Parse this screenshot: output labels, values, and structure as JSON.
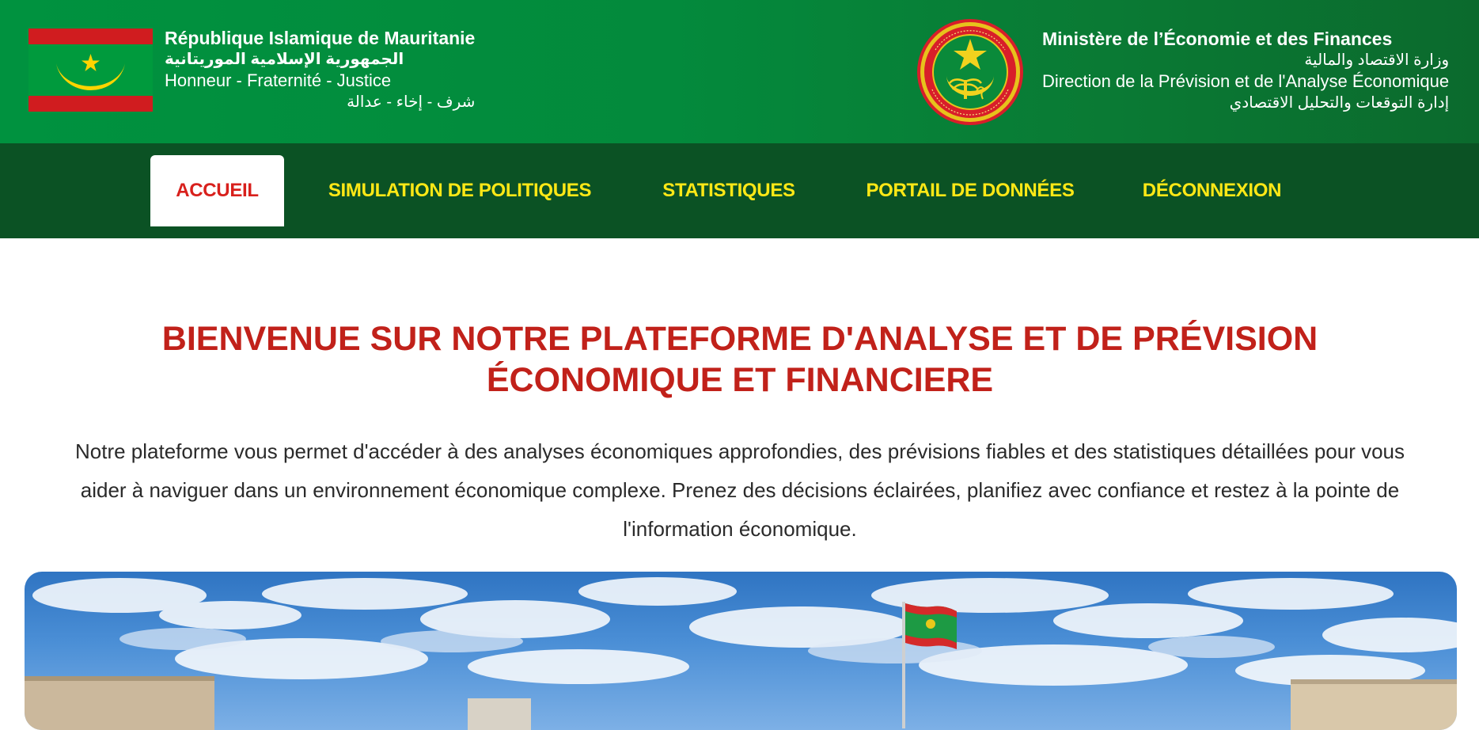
{
  "header": {
    "country_fr": "République Islamique de Mauritanie",
    "country_ar": "الجمهورية الإسلامية الموريتانية",
    "motto_fr": "Honneur - Fraternité - Justice",
    "motto_ar": "شرف - إخاء - عدالة",
    "ministry_fr": "Ministère de l’Économie et des Finances",
    "ministry_ar": "وزارة الاقتصاد والمالية",
    "direction_fr": "Direction de la Prévision et de l'Analyse Économique",
    "direction_ar": "إدارة التوقعات والتحليل الاقتصادي",
    "seal_icon": "national-seal-icon",
    "flag_icon": "mauritania-flag-icon",
    "colors": {
      "green": "#00923f",
      "dark_green": "#0b5224",
      "yellow": "#ffe816",
      "red": "#d01c1f"
    }
  },
  "nav": {
    "items": [
      {
        "label": "ACCUEIL",
        "active": true
      },
      {
        "label": "SIMULATION DE POLITIQUES",
        "active": false
      },
      {
        "label": "STATISTIQUES",
        "active": false
      },
      {
        "label": "PORTAIL DE DONNÉES",
        "active": false
      },
      {
        "label": "DÉCONNEXION",
        "active": false
      }
    ]
  },
  "main": {
    "title_line1": "BIENVENUE SUR NOTRE PLATEFORME D'ANALYSE ET DE PRÉVISION",
    "title_line2": "ÉCONOMIQUE ET FINANCIERE",
    "intro_line1": "Notre plateforme vous permet d'accéder à des analyses économiques approfondies, des prévisions fiables et des statistiques détaillées pour vous",
    "intro_line2": "aider à naviguer dans un environnement économique complexe. Prenez des décisions éclairées, planifiez avec confiance et restez à la pointe de",
    "intro_line3": "l'information économique.",
    "hero_image": "building-with-flag-image",
    "title_color": "#c1211a"
  }
}
